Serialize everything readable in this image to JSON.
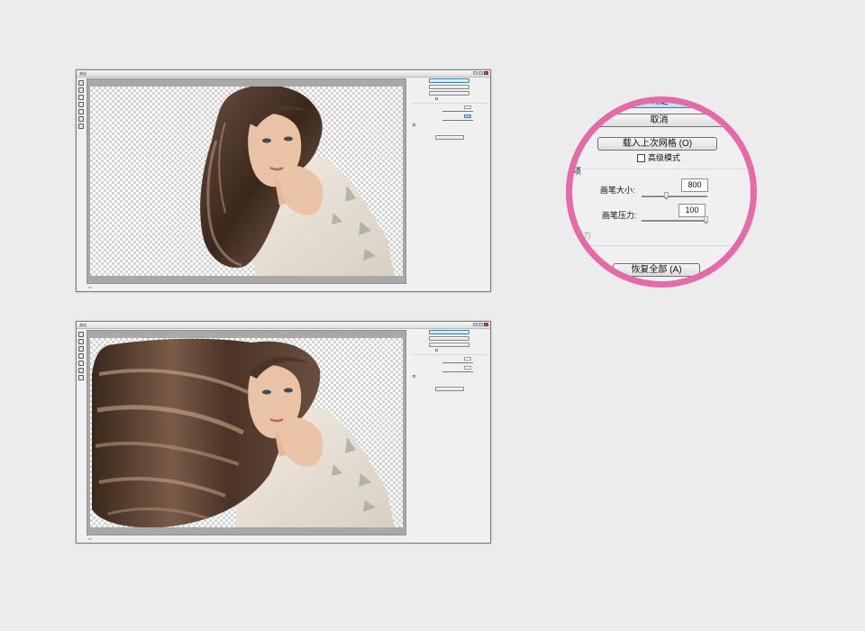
{
  "zoom_panel": {
    "confirm_label": "确定",
    "cancel_label": "取消",
    "load_mesh_label": "载入上次网格 (O)",
    "advanced_mode_label": "高级模式",
    "options_label": "选项",
    "brush_size_label": "画笔大小:",
    "brush_size_value": "800",
    "brush_pressure_label": "画笔压力:",
    "brush_pressure_value": "100",
    "pressure_label": "压力",
    "restore_all_label": "恢复全部 (A)"
  },
  "colors": {
    "highlight_ring": "#e56aa9",
    "primary_button": "#b3dff7",
    "background": "#ececec"
  }
}
